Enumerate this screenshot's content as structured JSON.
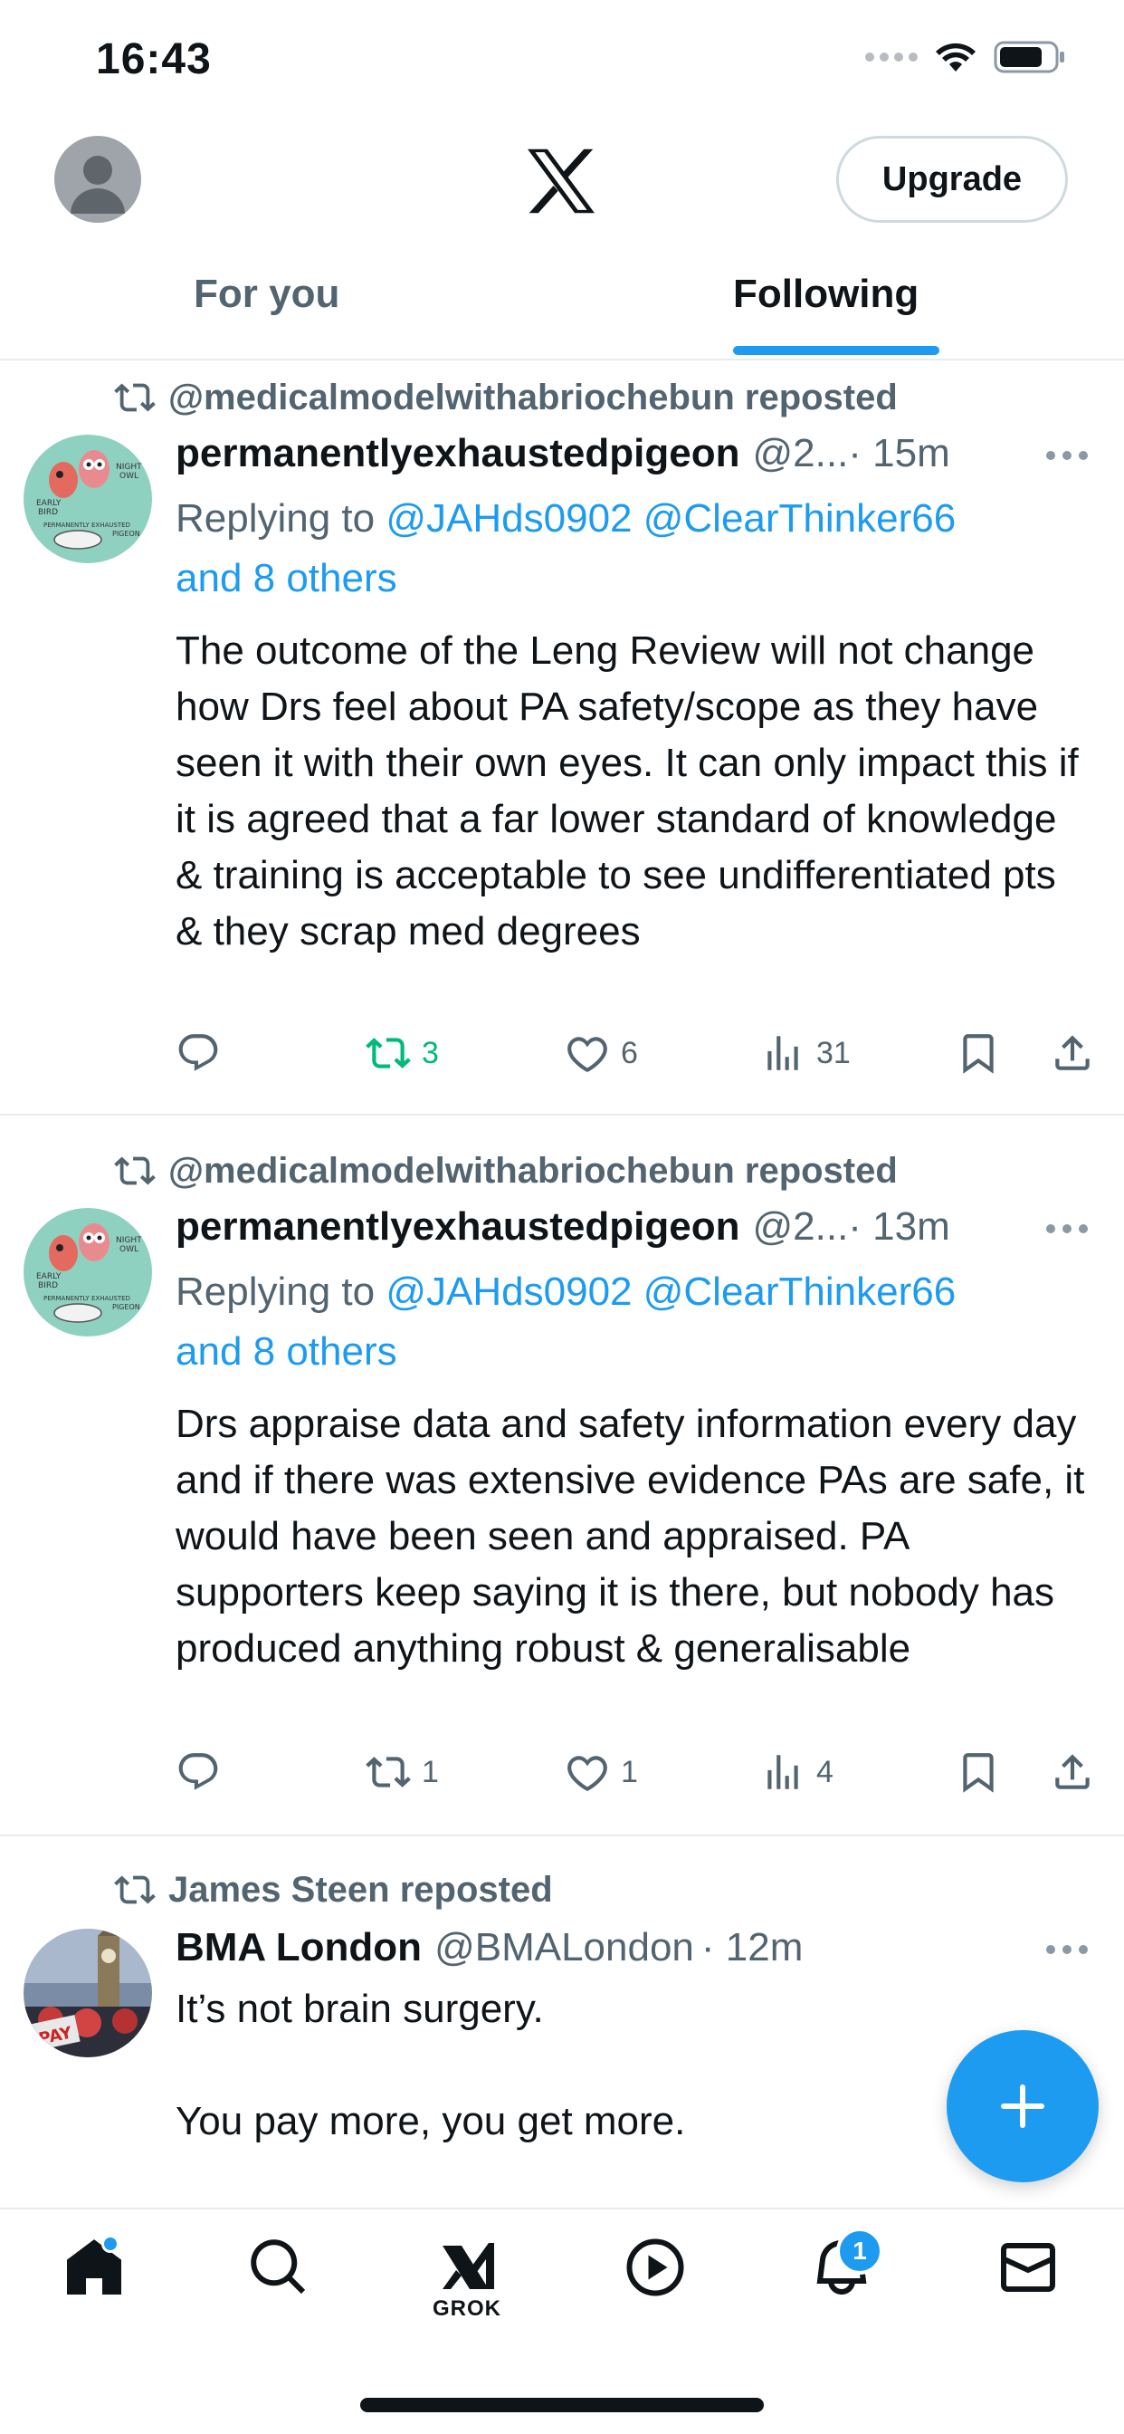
{
  "status_bar": {
    "time": "16:43"
  },
  "header": {
    "upgrade_label": "Upgrade"
  },
  "tabs": [
    {
      "label": "For you",
      "active": false
    },
    {
      "label": "Following",
      "active": true
    }
  ],
  "posts": [
    {
      "repost_by": "@medicalmodelwithabriochebun reposted",
      "name": "permanentlyexhaustedpigeon",
      "handle": "@2...",
      "time": "· 15m",
      "replying_prefix": "Replying to",
      "mentions": "@JAHds0902 @ClearThinker66",
      "and_others": "and 8 others",
      "text": "The outcome of the Leng Review will not change how Drs feel about PA safety/scope as they have seen it with their own eyes. It can only impact this if it is agreed that a far lower standard of knowledge & training is acceptable to see undifferentiated pts & they scrap med degrees",
      "reposts": "3",
      "likes": "6",
      "views": "31",
      "reposted_by_me": true
    },
    {
      "repost_by": "@medicalmodelwithabriochebun reposted",
      "name": "permanentlyexhaustedpigeon",
      "handle": "@2...",
      "time": "· 13m",
      "replying_prefix": "Replying to",
      "mentions": "@JAHds0902 @ClearThinker66",
      "and_others": "and 8 others",
      "text": "Drs appraise data and safety information every day and if there was extensive evidence PAs are safe, it would have been seen and appraised. PA supporters keep saying it is there, but nobody has produced anything robust & generalisable",
      "reposts": "1",
      "likes": "1",
      "views": "4",
      "reposted_by_me": false
    },
    {
      "repost_by": "James Steen reposted",
      "name": "BMA London",
      "handle": "@BMALondon",
      "time": "· 12m",
      "text": "It’s not brain surgery.\n\nYou pay more, you get more."
    }
  ],
  "avatar_art_text": {
    "early_bird": "EARLY BIRD",
    "night_owl": "NIGHT OWL",
    "pigeon": "PERMANENTLY EXHAUSTED PIGEON",
    "sign": "PAY"
  },
  "bottom_nav": {
    "grok_label": "GROK",
    "notification_count": "1"
  },
  "colors": {
    "accent": "#1d9bf0",
    "repost_green": "#00ba7c",
    "secondary_text": "#536471"
  }
}
